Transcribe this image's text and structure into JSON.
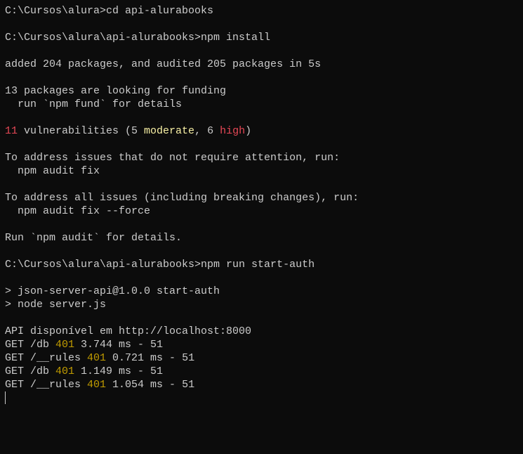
{
  "colors": {
    "background": "#0c0c0c",
    "foreground": "#cccccc",
    "red": "#e74856",
    "light_yellow": "#f9f1a5",
    "yellow": "#c19c00"
  },
  "lines": [
    [
      {
        "t": "C:\\Cursos\\alura>cd api-alurabooks"
      }
    ],
    [],
    [
      {
        "t": "C:\\Cursos\\alura\\api-alurabooks>npm install"
      }
    ],
    [],
    [
      {
        "t": "added 204 packages, and audited 205 packages in 5s"
      }
    ],
    [],
    [
      {
        "t": "13 packages are looking for funding"
      }
    ],
    [
      {
        "t": "  run `npm fund` for details"
      }
    ],
    [],
    [
      {
        "t": "11",
        "c": "red"
      },
      {
        "t": " vulnerabilities (5 "
      },
      {
        "t": "moderate",
        "c": "light_yellow"
      },
      {
        "t": ", 6 "
      },
      {
        "t": "high",
        "c": "red"
      },
      {
        "t": ")"
      }
    ],
    [],
    [
      {
        "t": "To address issues that do not require attention, run:"
      }
    ],
    [
      {
        "t": "  npm audit fix"
      }
    ],
    [],
    [
      {
        "t": "To address all issues (including breaking changes), run:"
      }
    ],
    [
      {
        "t": "  npm audit fix --force"
      }
    ],
    [],
    [
      {
        "t": "Run `npm audit` for details."
      }
    ],
    [],
    [
      {
        "t": "C:\\Cursos\\alura\\api-alurabooks>npm run start-auth"
      }
    ],
    [],
    [
      {
        "t": "> json-server-api@1.0.0 start-auth"
      }
    ],
    [
      {
        "t": "> node server.js"
      }
    ],
    [],
    [
      {
        "t": "API disponível em http://localhost:8000"
      }
    ],
    [
      {
        "t": "GET /db "
      },
      {
        "t": "401",
        "c": "yellow"
      },
      {
        "t": " 3.744 ms - 51"
      }
    ],
    [
      {
        "t": "GET /__rules "
      },
      {
        "t": "401",
        "c": "yellow"
      },
      {
        "t": " 0.721 ms - 51"
      }
    ],
    [
      {
        "t": "GET /db "
      },
      {
        "t": "401",
        "c": "yellow"
      },
      {
        "t": " 1.149 ms - 51"
      }
    ],
    [
      {
        "t": "GET /__rules "
      },
      {
        "t": "401",
        "c": "yellow"
      },
      {
        "t": " 1.054 ms - 51"
      }
    ]
  ]
}
